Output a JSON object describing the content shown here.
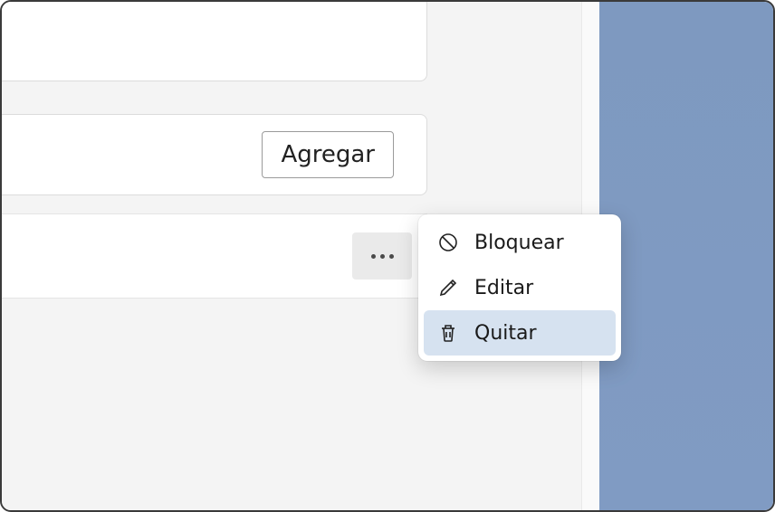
{
  "buttons": {
    "add_label": "Agregar"
  },
  "menu": {
    "block_label": "Bloquear",
    "edit_label": "Editar",
    "remove_label": "Quitar"
  }
}
